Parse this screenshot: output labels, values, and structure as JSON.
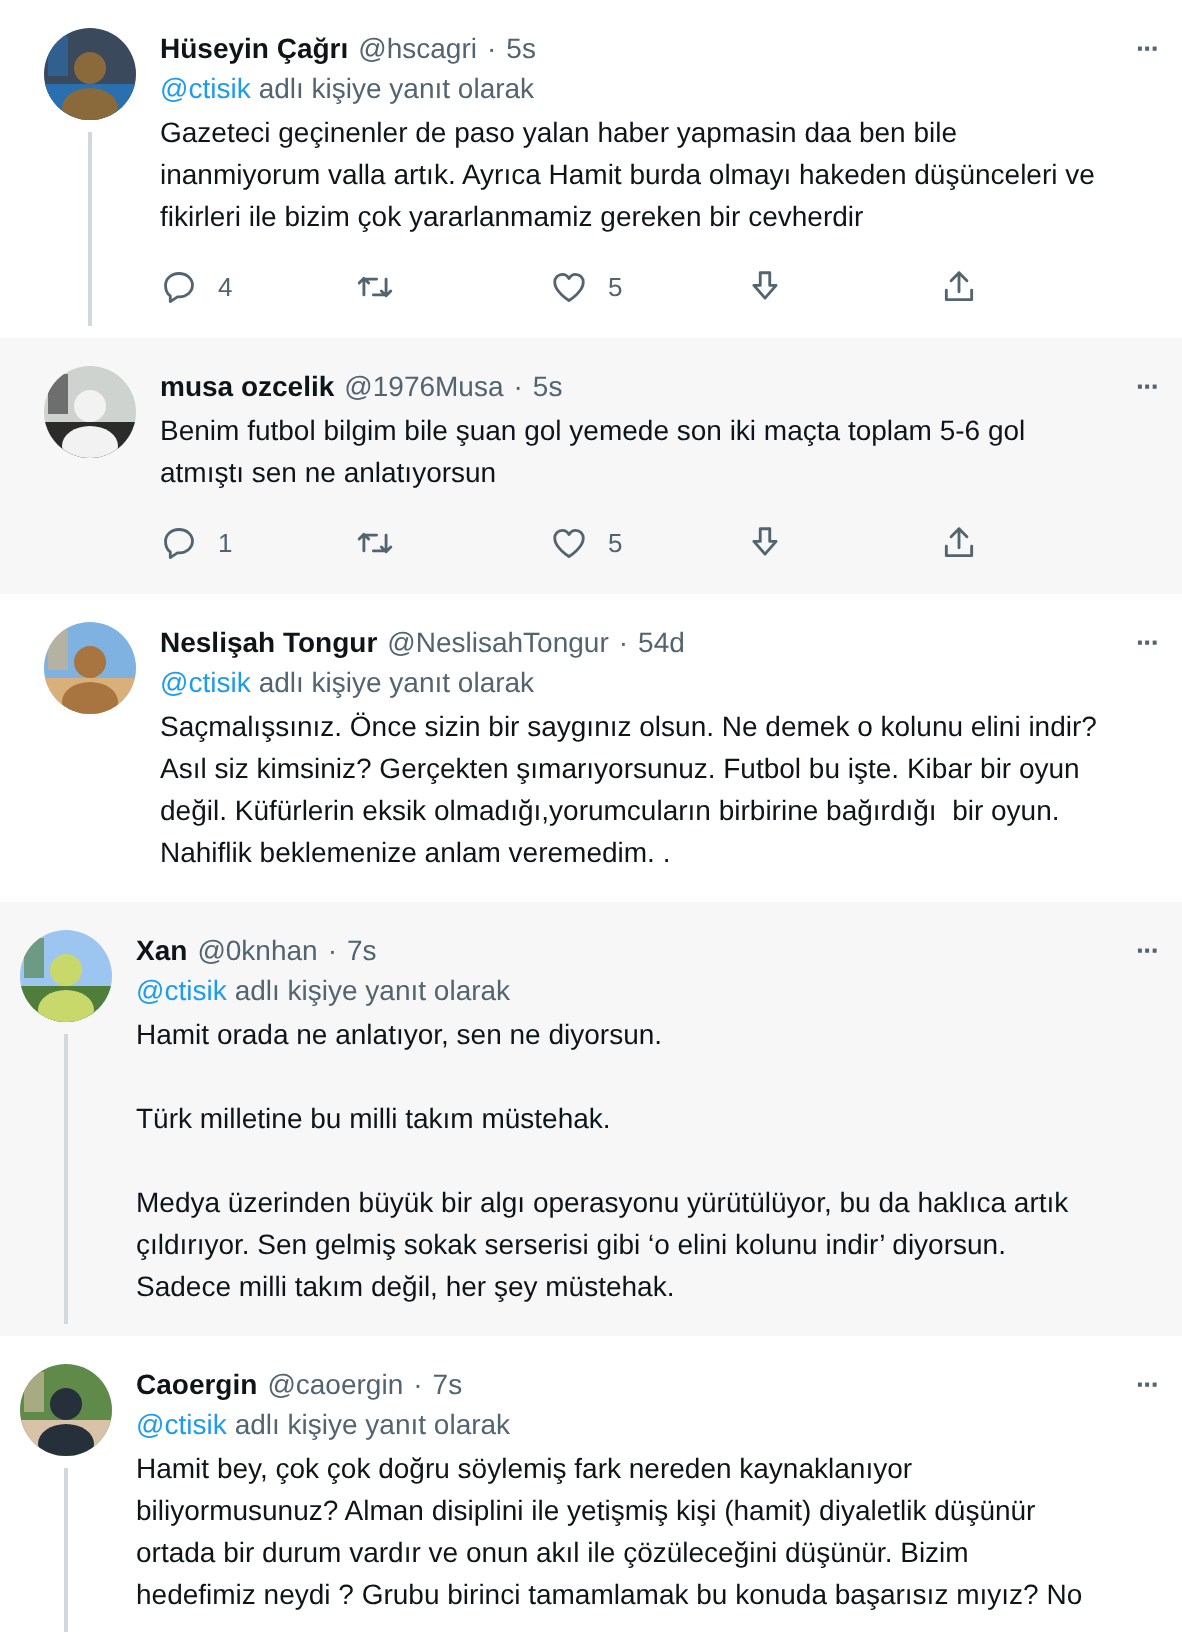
{
  "tweets": [
    {
      "name": "Hüseyin Çağrı",
      "handle": "@hscagri",
      "sep": "·",
      "time": "5s",
      "reply_to": "@ctisik",
      "reply_suffix": "adlı kişiye yanıt olarak",
      "shaded": false,
      "thread": true,
      "indent": false,
      "body": "Gazeteci geçinenler de paso yalan haber yapmasin daa ben bile\ninanmiyorum valla artık. Ayrıca Hamit burda olmayı hakeden düşünceleri ve\nfikirleri ile bizim çok yararlanmamiz gereken bir cevherdir",
      "more": "···",
      "actions": {
        "replies": "4",
        "likes": "5"
      }
    },
    {
      "name": "musa ozcelik",
      "handle": "@1976Musa",
      "sep": "·",
      "time": "5s",
      "shaded": true,
      "thread": false,
      "indent": false,
      "body": "Benim futbol bilgim bile şuan gol yemede son iki maçta toplam 5-6 gol\natmıştı sen ne anlatıyorsun",
      "more": "···",
      "actions": {
        "replies": "1",
        "likes": "5"
      }
    },
    {
      "name": "Neslişah Tongur",
      "handle": "@NeslisahTongur",
      "sep": "·",
      "time": "54d",
      "reply_to": "@ctisik",
      "reply_suffix": "adlı kişiye yanıt olarak",
      "shaded": false,
      "thread": false,
      "indent": false,
      "body": "Saçmalışsınız. Önce sizin bir saygınız olsun. Ne demek o kolunu elini indir?\nAsıl siz kimsiniz? Gerçekten şımarıyorsunuz. Futbol bu işte. Kibar bir oyun\ndeğil. Küfürlerin eksik olmadığı,yorumcuların birbirine bağırdığı  bir oyun.\nNahiflik beklemenize anlam veremedim. .",
      "more": "···"
    },
    {
      "name": "Xan",
      "handle": "@0knhan",
      "sep": "·",
      "time": "7s",
      "reply_to": "@ctisik",
      "reply_suffix": "adlı kişiye yanıt olarak",
      "shaded": true,
      "thread": true,
      "indent": true,
      "body": "Hamit orada ne anlatıyor, sen ne diyorsun.\n\nTürk milletine bu milli takım müstehak.\n\nMedya üzerinden büyük bir algı operasyonu yürütülüyor, bu da haklıca artık\nçıldırıyor. Sen gelmiş sokak serserisi gibi ‘o elini kolunu indir’ diyorsun.\nSadece milli takım değil, her şey müstehak.",
      "more": "···"
    },
    {
      "name": "Caoergin",
      "handle": "@caoergin",
      "sep": "·",
      "time": "7s",
      "reply_to": "@ctisik",
      "reply_suffix": "adlı kişiye yanıt olarak",
      "shaded": false,
      "thread": true,
      "indent": true,
      "body": "Hamit bey, çok çok doğru söylemiş fark nereden kaynaklanıyor\nbiliyormusunuz? Alman disiplini ile yetişmiş kişi (hamit) diyaletlik düşünür\nortada bir durum vardır ve onun akıl ile çözüleceğini düşünür. Bizim\nhedefimiz neydi ? Grubu birinci tamamlamak bu konuda başarısız mıyız? No",
      "more": "···"
    }
  ]
}
